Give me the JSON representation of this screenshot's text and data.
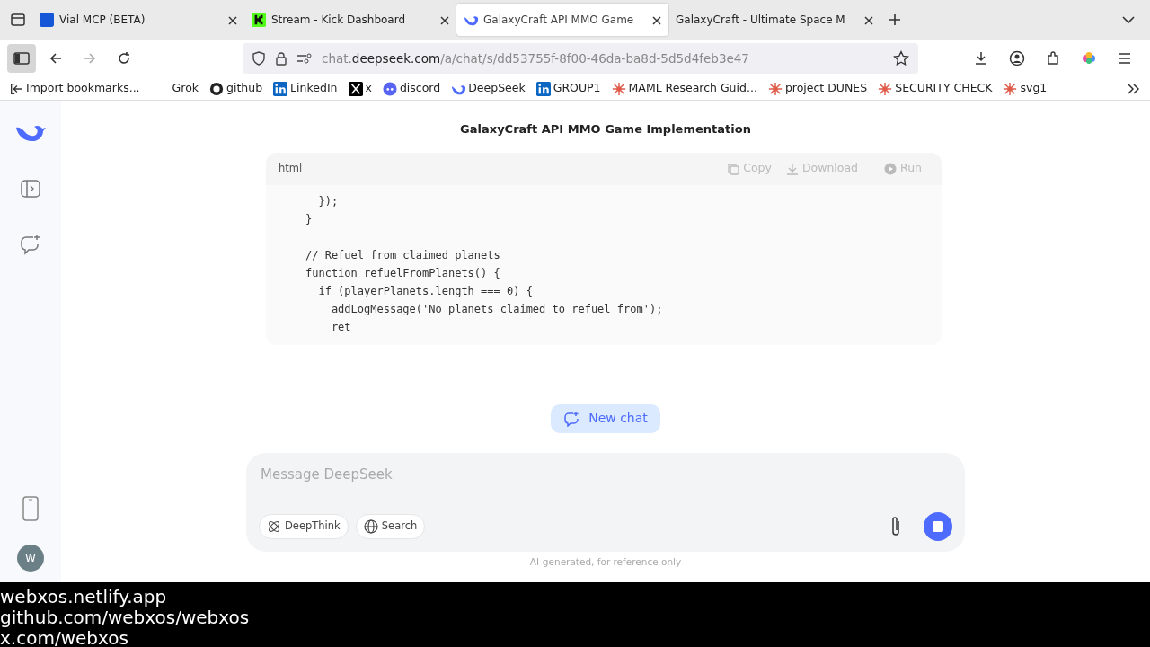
{
  "tabs": [
    {
      "title": "Vial MCP (BETA)",
      "selected": false
    },
    {
      "title": "Stream - Kick Dashboard",
      "selected": false
    },
    {
      "title": "GalaxyCraft API MMO Game",
      "selected": true
    },
    {
      "title": "GalaxyCraft - Ultimate Space M",
      "selected": false
    }
  ],
  "address": {
    "host_prefix": "chat.",
    "host": "deepseek.com",
    "path": "/a/chat/s/dd53755f-8f00-46da-ba8d-5d5d4feb3e47"
  },
  "bookmarks": [
    {
      "label": "Import bookmarks..."
    },
    {
      "label": "Grok"
    },
    {
      "label": "github"
    },
    {
      "label": "LinkedIn"
    },
    {
      "label": "x"
    },
    {
      "label": "discord"
    },
    {
      "label": "DeepSeek"
    },
    {
      "label": "GROUP1"
    },
    {
      "label": "MAML Research Guid..."
    },
    {
      "label": "project DUNES"
    },
    {
      "label": "SECURITY CHECK"
    },
    {
      "label": "svg1"
    }
  ],
  "chat": {
    "title": "GalaxyCraft API MMO Game Implementation",
    "code": {
      "language": "html",
      "actions": [
        "Copy",
        "Download",
        "Run"
      ],
      "paragraphs": [
        [
          "  });",
          "}"
        ],
        [
          "// Refuel from claimed planets",
          "function refuelFromPlanets() {",
          "  if (playerPlanets.length === 0) {",
          "    addLogMessage('No planets claimed to refuel from');",
          "    ret"
        ]
      ]
    },
    "new_chat": "New chat",
    "input": {
      "placeholder": "Message DeepSeek",
      "buttons": [
        "DeepThink",
        "Search"
      ]
    },
    "footnote": "AI-generated, for reference only"
  },
  "avatar": "W",
  "overlay": [
    "webxos.netlify.app",
    "github.com/webxos/webxos",
    "x.com/webxos"
  ]
}
